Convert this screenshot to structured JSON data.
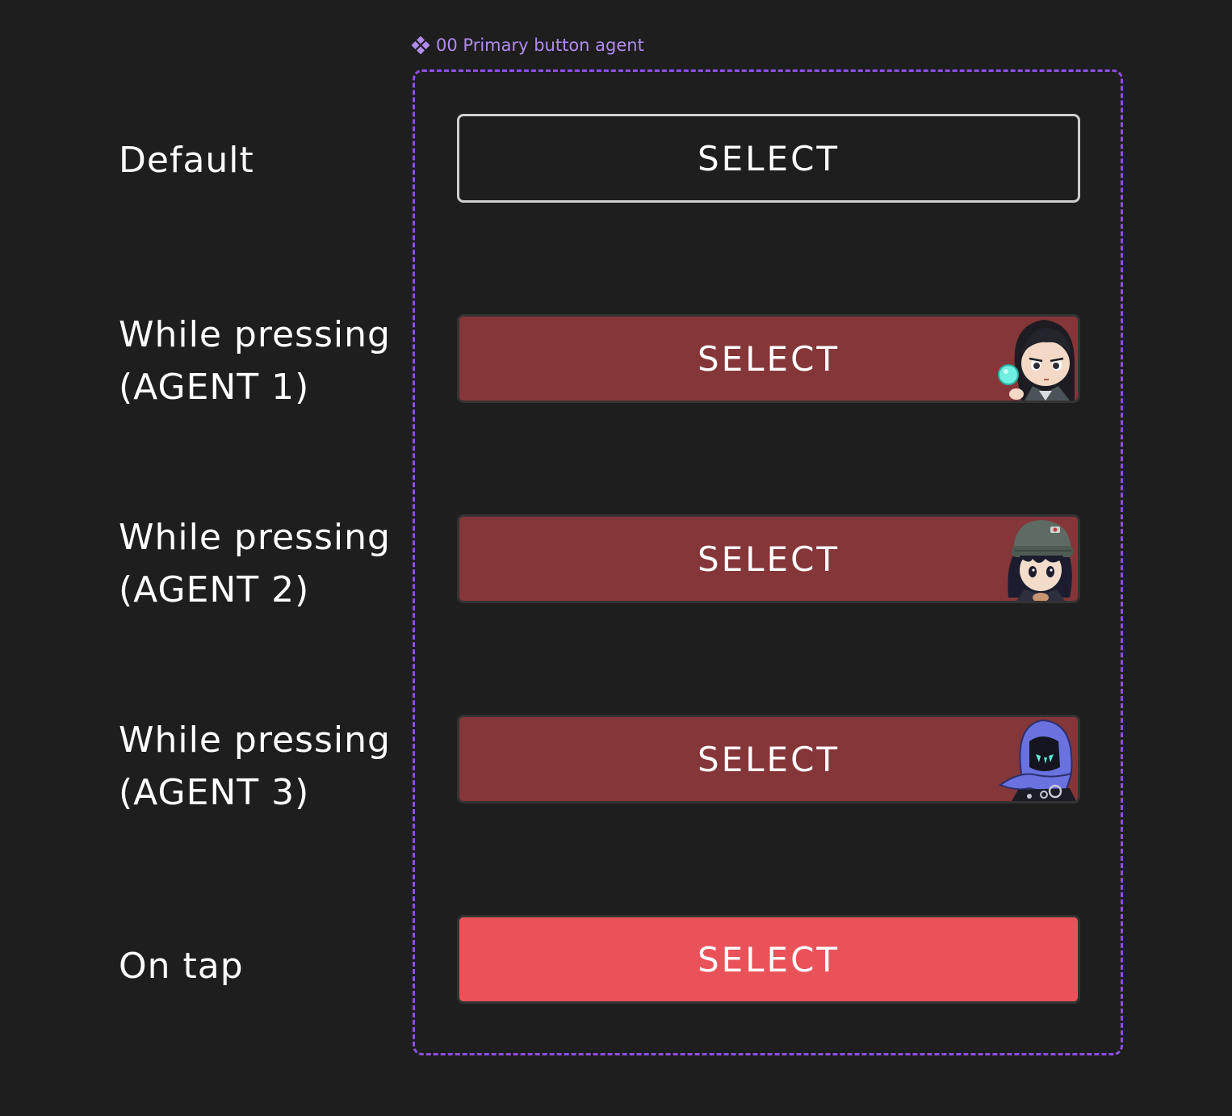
{
  "component": {
    "label": "00 Primary button agent",
    "accent_color": "#8e4fe9",
    "label_color": "#b28bf0",
    "icon": "component-diamond-icon"
  },
  "rows": [
    {
      "state": "default",
      "label_lines": [
        "Default"
      ],
      "button_label": "SELECT",
      "style": "outline"
    },
    {
      "state": "pressing-agent-1",
      "label_lines": [
        "While pressing",
        "(AGENT 1)"
      ],
      "button_label": "SELECT",
      "style": "pressed",
      "avatar": "agent-1-avatar-icon"
    },
    {
      "state": "pressing-agent-2",
      "label_lines": [
        "While pressing",
        "(AGENT 2)"
      ],
      "button_label": "SELECT",
      "style": "pressed",
      "avatar": "agent-2-avatar-icon"
    },
    {
      "state": "pressing-agent-3",
      "label_lines": [
        "While pressing",
        "(AGENT 3)"
      ],
      "button_label": "SELECT",
      "style": "pressed",
      "avatar": "agent-3-avatar-icon"
    },
    {
      "state": "on-tap",
      "label_lines": [
        "On tap"
      ],
      "button_label": "SELECT",
      "style": "tap"
    }
  ],
  "colors": {
    "background": "#1e1e1e",
    "pressed": "#853639",
    "tap": "#ea5259",
    "outline": "#cfcfcf"
  }
}
